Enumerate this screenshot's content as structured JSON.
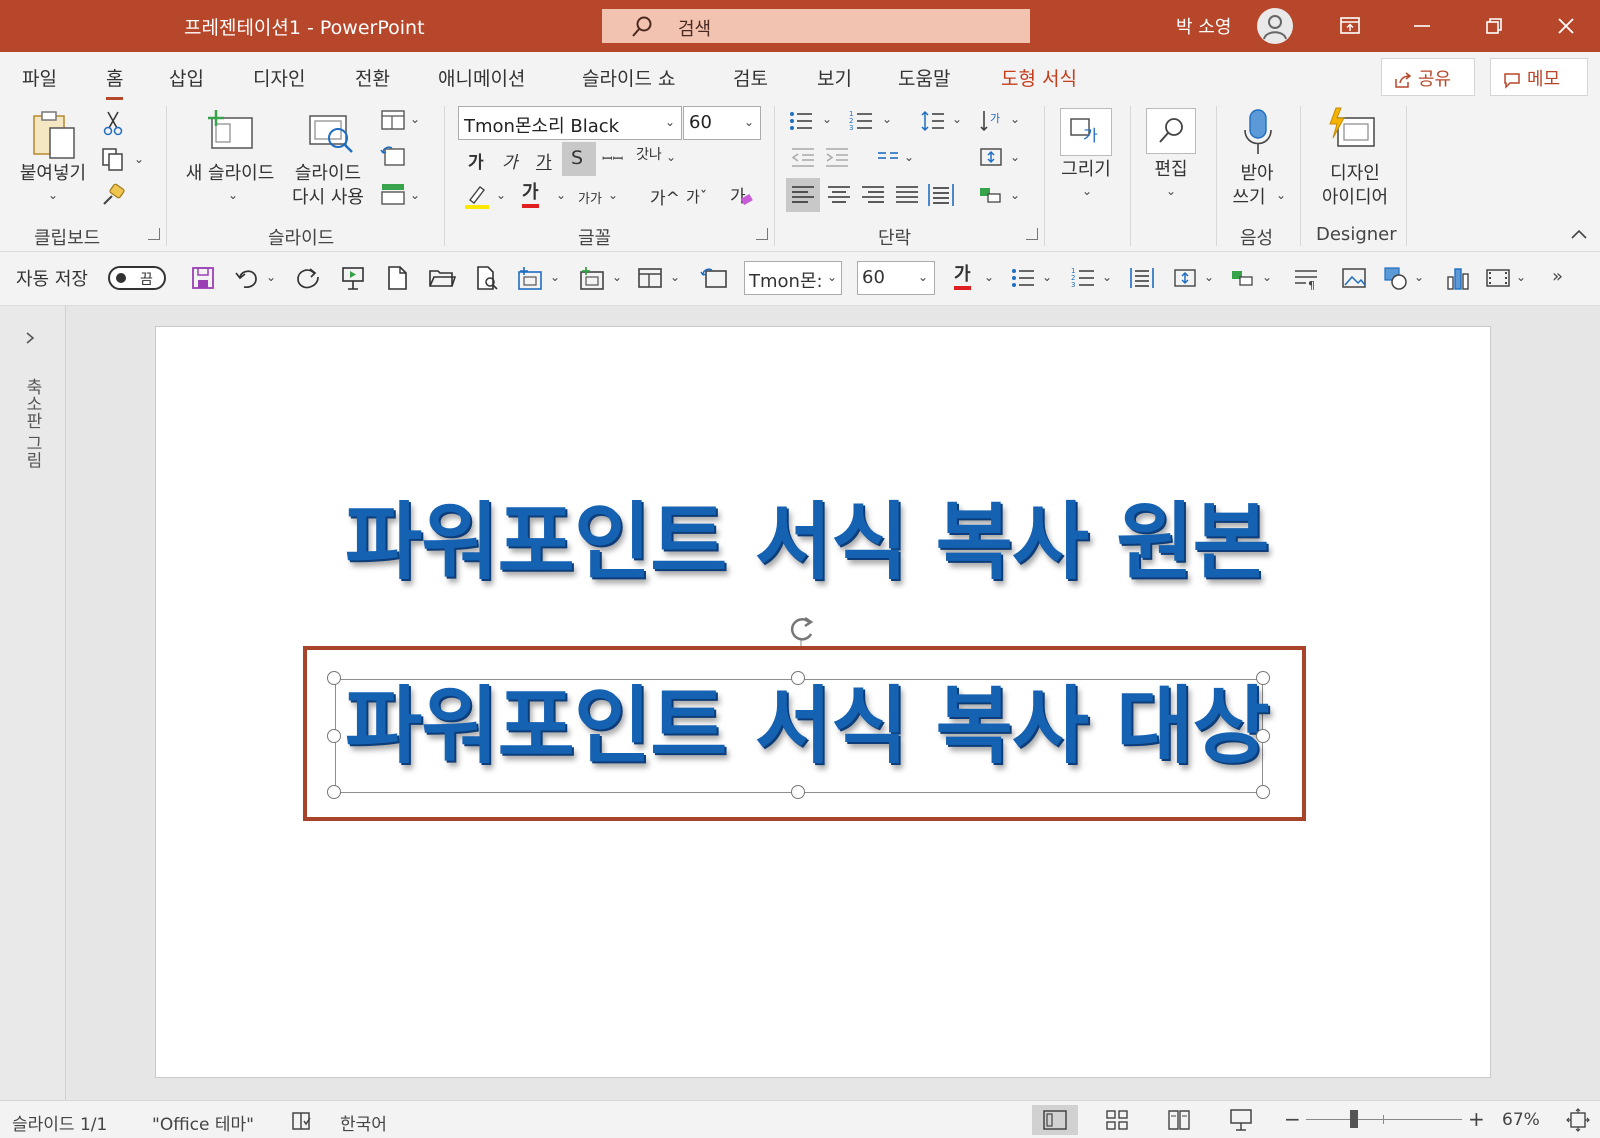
{
  "window": {
    "title": "프레젠테이션1  -  PowerPoint",
    "search_placeholder": "검색",
    "user": "박 소영",
    "accent_color": "#b7472a"
  },
  "tabs": [
    {
      "label": "파일"
    },
    {
      "label": "홈",
      "active": true
    },
    {
      "label": "삽입"
    },
    {
      "label": "디자인"
    },
    {
      "label": "전환"
    },
    {
      "label": "애니메이션"
    },
    {
      "label": "슬라이드 쇼"
    },
    {
      "label": "검토"
    },
    {
      "label": "보기"
    },
    {
      "label": "도움말"
    },
    {
      "label": "도형 서식",
      "contextual": true
    }
  ],
  "top_buttons": {
    "share": "공유",
    "comments": "메모"
  },
  "ribbon": {
    "clipboard": {
      "label": "클립보드",
      "paste": "붙여넣기"
    },
    "slides": {
      "label": "슬라이드",
      "new_slide": "새 슬라이드",
      "reuse_line1": "슬라이드",
      "reuse_line2": "다시 사용"
    },
    "font": {
      "label": "글꼴",
      "font_name": "Tmon몬소리 Black",
      "font_size": "60",
      "bold": "가",
      "italic": "가",
      "underline": "가",
      "shadow": "S",
      "strike": "ꟷꟷ",
      "spacing": "갓나",
      "font_color_glyph": "가",
      "case_glyph": "가가",
      "grow": "가^",
      "shrink": "가ˇ",
      "clear": "가"
    },
    "paragraph": {
      "label": "단락"
    },
    "drawing": {
      "label": "그리기"
    },
    "editing": {
      "label": "편집"
    },
    "voice": {
      "label": "음성",
      "dictate_line1": "받아",
      "dictate_line2": "쓰기"
    },
    "designer": {
      "label": "Designer",
      "ideas_line1": "디자인",
      "ideas_line2": "아이디어"
    }
  },
  "qat": {
    "autosave": "자동 저장",
    "toggle_state": "끔",
    "font_name": "Tmon몬:",
    "font_size": "60",
    "font_color_glyph": "가"
  },
  "left_pane": {
    "label": "축소판 그림"
  },
  "slide": {
    "text_original": "파워포인트 서식 복사 원본",
    "text_target": "파워포인트 서식 복사 대상"
  },
  "statusbar": {
    "slide_count": "슬라이드 1/1",
    "theme": "\"Office 테마\"",
    "language": "한국어",
    "zoom": "67%",
    "zoom_fraction": 0.67
  }
}
